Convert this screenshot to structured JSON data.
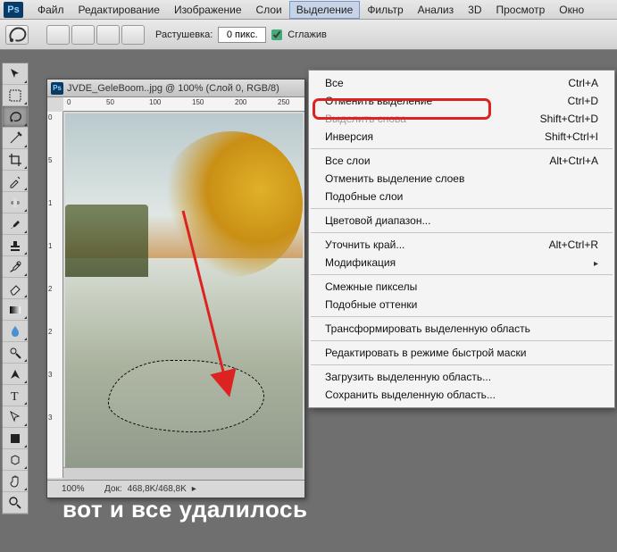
{
  "menubar": {
    "items": [
      "Файл",
      "Редактирование",
      "Изображение",
      "Слои",
      "Выделение",
      "Фильтр",
      "Анализ",
      "3D",
      "Просмотр",
      "Окно"
    ],
    "activeIndex": 4
  },
  "options": {
    "feather_label": "Растушевка:",
    "feather_value": "0 пикс.",
    "antialias_label": "Сглажив"
  },
  "document": {
    "title": "JVDE_GeleBoom..jpg @ 100% (Слой 0, RGB/8)",
    "zoom": "100%",
    "doc_label": "Док:",
    "doc_size": "468,8K/468,8K",
    "ruler_h": [
      "0",
      "50",
      "100",
      "150",
      "200",
      "250"
    ],
    "ruler_v": [
      "0",
      "5",
      "1",
      "1",
      "2",
      "2",
      "3",
      "3"
    ]
  },
  "menu": {
    "items": [
      {
        "label": "Все",
        "shortcut": "Ctrl+A",
        "enabled": true
      },
      {
        "label": "Отменить выделение",
        "shortcut": "Ctrl+D",
        "enabled": true,
        "highlighted": true
      },
      {
        "label": "Выделить снова",
        "shortcut": "Shift+Ctrl+D",
        "enabled": false
      },
      {
        "label": "Инверсия",
        "shortcut": "Shift+Ctrl+I",
        "enabled": true
      },
      {
        "sep": true
      },
      {
        "label": "Все слои",
        "shortcut": "Alt+Ctrl+A",
        "enabled": true
      },
      {
        "label": "Отменить выделение слоев",
        "enabled": true
      },
      {
        "label": "Подобные слои",
        "enabled": true
      },
      {
        "sep": true
      },
      {
        "label": "Цветовой диапазон...",
        "enabled": true
      },
      {
        "sep": true
      },
      {
        "label": "Уточнить край...",
        "shortcut": "Alt+Ctrl+R",
        "enabled": true
      },
      {
        "label": "Модификация",
        "enabled": true,
        "submenu": true
      },
      {
        "sep": true
      },
      {
        "label": "Смежные пикселы",
        "enabled": true
      },
      {
        "label": "Подобные оттенки",
        "enabled": true
      },
      {
        "sep": true
      },
      {
        "label": "Трансформировать выделенную область",
        "enabled": true
      },
      {
        "sep": true
      },
      {
        "label": "Редактировать в режиме быстрой маски",
        "enabled": true
      },
      {
        "sep": true
      },
      {
        "label": "Загрузить выделенную область...",
        "enabled": true
      },
      {
        "label": "Сохранить выделенную область...",
        "enabled": true
      }
    ]
  },
  "caption": "вот и все удалилось",
  "logo": "Ps"
}
